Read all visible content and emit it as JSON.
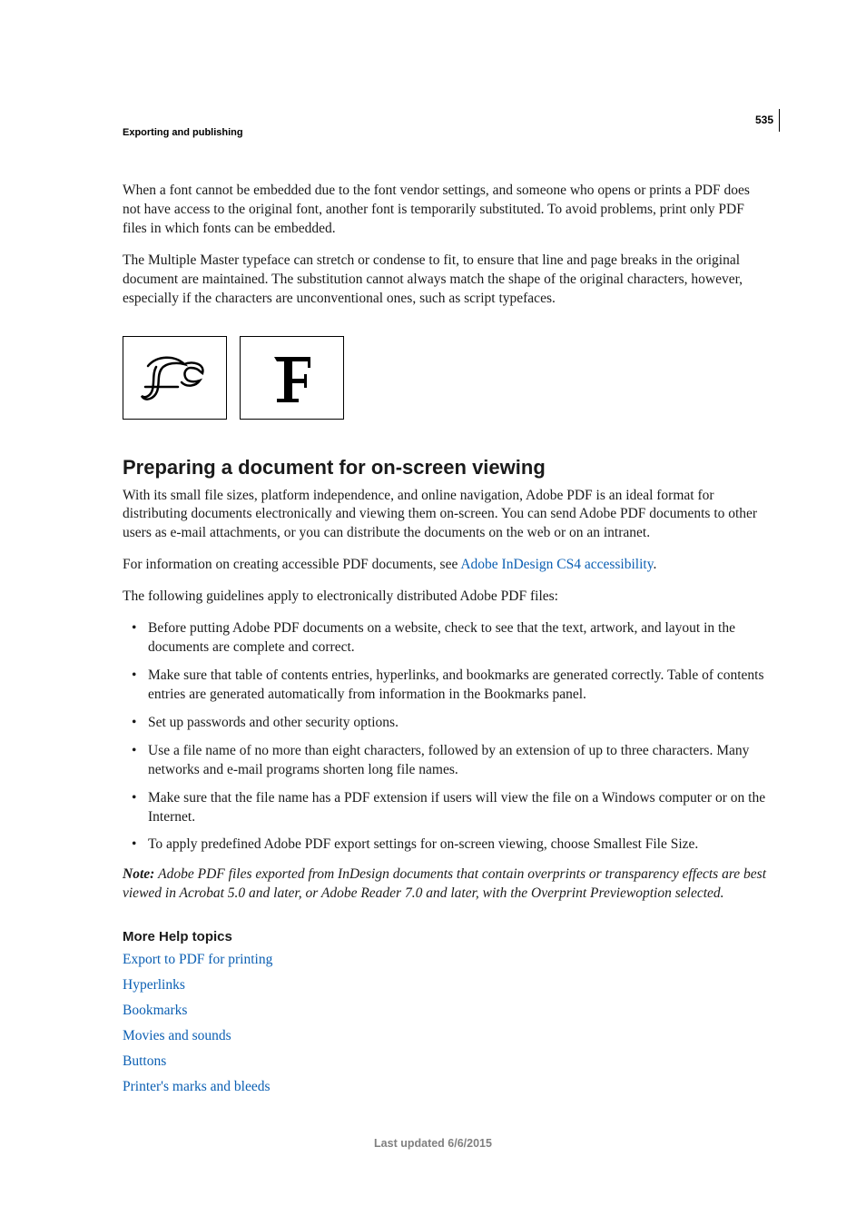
{
  "page_number": "535",
  "header_section": "Exporting and publishing",
  "para1": "When a font cannot be embedded due to the font vendor settings, and someone who opens or prints a PDF does not have access to the original font, another font is temporarily substituted. To avoid problems, print only PDF files in which fonts can be embedded.",
  "para2": "The Multiple Master typeface can stretch or condense to fit, to ensure that line and page breaks in the original document are maintained. The substitution cannot always match the shape of the original characters, however, especially if the characters are unconventional ones, such as script typefaces.",
  "heading": "Preparing a document for on-screen viewing",
  "para3": "With its small file sizes, platform independence, and online navigation, Adobe PDF is an ideal format for distributing documents electronically and viewing them on-screen. You can send Adobe PDF documents to other users as e-mail attachments, or you can distribute the documents on the web or on an intranet.",
  "para4_prefix": "For information on creating accessible PDF documents, see ",
  "para4_link": "Adobe InDesign CS4 accessibility",
  "para4_suffix": ".",
  "para5": "The following guidelines apply to electronically distributed Adobe PDF files:",
  "bullets": [
    "Before putting Adobe PDF documents on a website, check to see that the text, artwork, and layout in the documents are complete and correct.",
    "Make sure that table of contents entries, hyperlinks, and bookmarks are generated correctly. Table of contents entries are generated automatically from information in the Bookmarks panel.",
    "Set up passwords and other security options.",
    "Use a file name of no more than eight characters, followed by an extension of up to three characters. Many networks and e-mail programs shorten long file names.",
    "Make sure that the file name has a PDF extension if users will view the file on a Windows computer or on the Internet.",
    "To apply predefined Adobe PDF export settings for on-screen viewing, choose Smallest File Size."
  ],
  "note_label": "Note: ",
  "note_text": "Adobe PDF files exported from InDesign documents that contain overprints or transparency effects are best viewed in Acrobat 5.0 and later, or Adobe Reader 7.0 and later, with the Overprint Previewoption selected.",
  "help_heading": "More Help topics",
  "help_links": [
    "Export to PDF for printing",
    "Hyperlinks",
    "Bookmarks",
    "Movies and sounds",
    "Buttons",
    "Printer's marks and bleeds"
  ],
  "footer": "Last updated 6/6/2015"
}
